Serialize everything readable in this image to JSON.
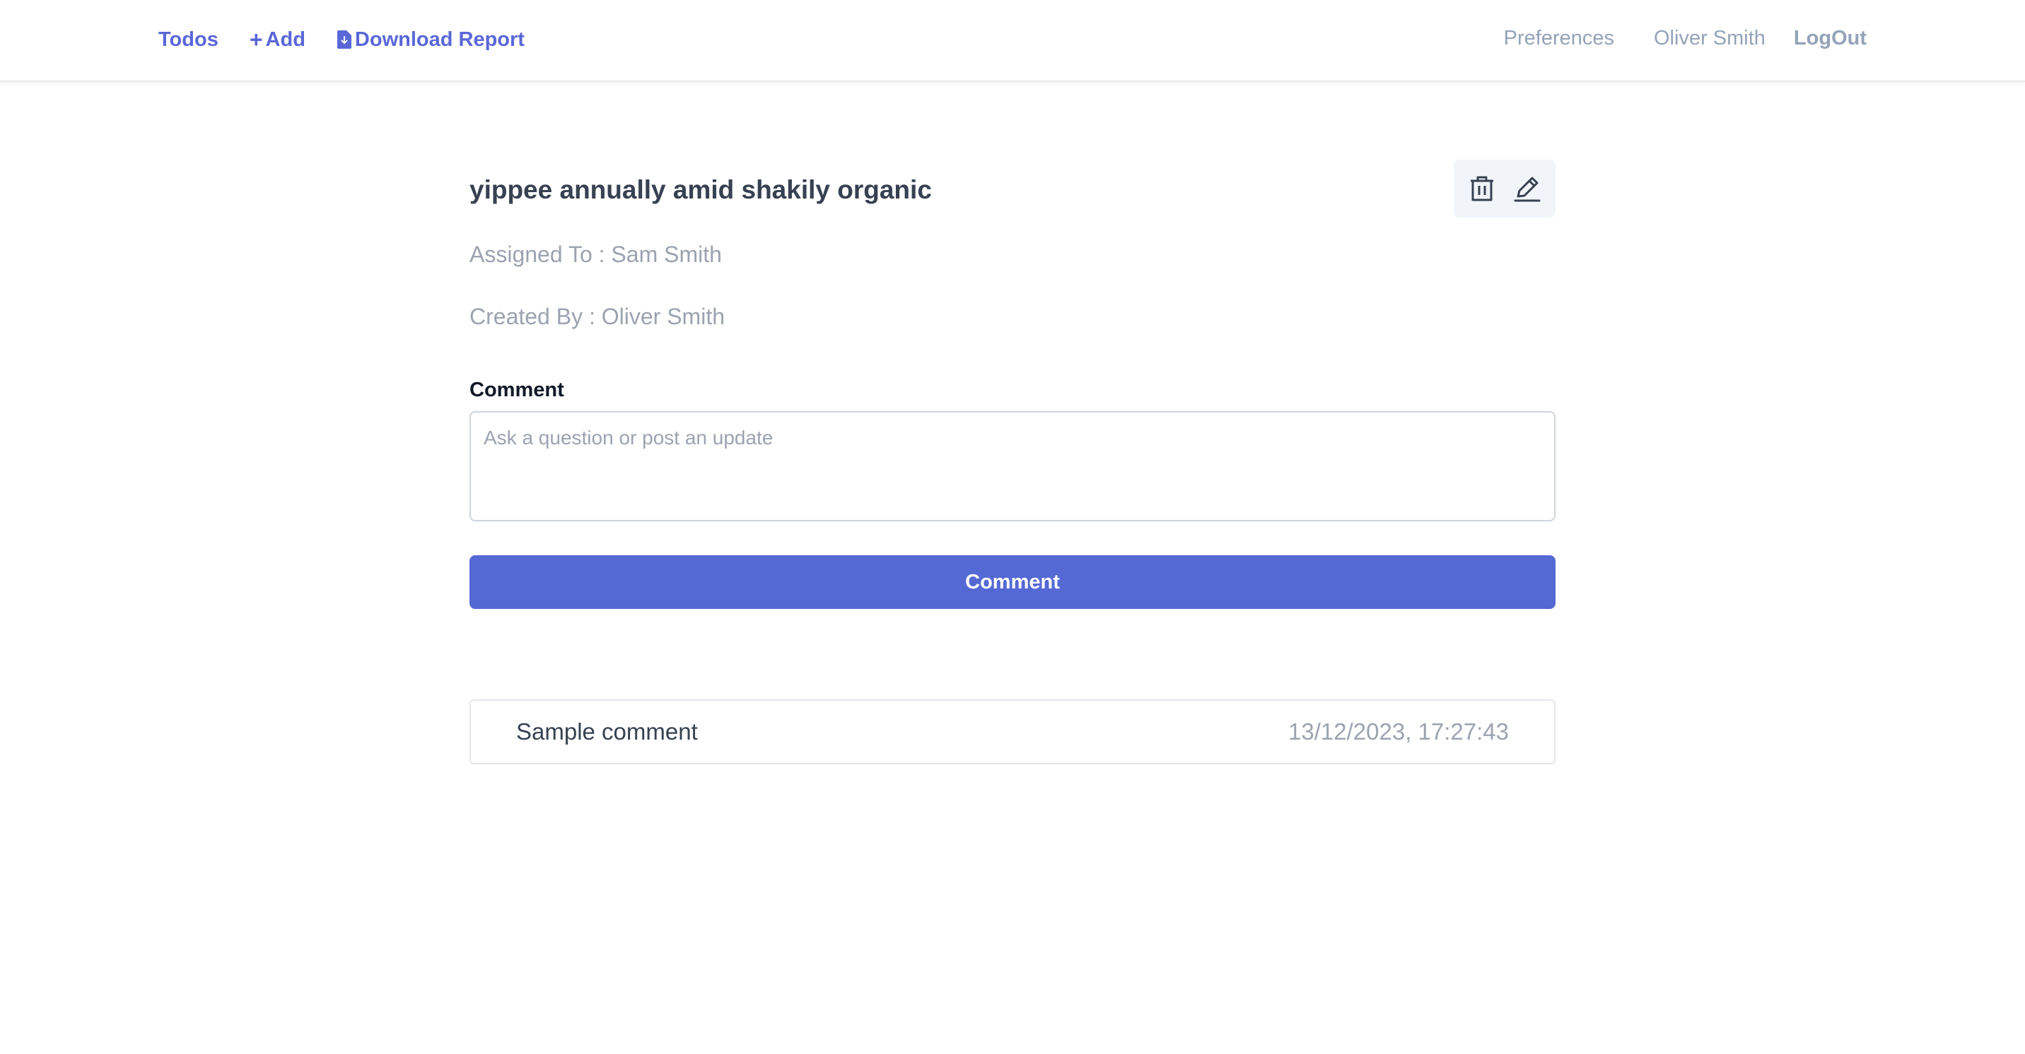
{
  "nav": {
    "todos_label": "Todos",
    "add_label": "Add",
    "download_label": "Download Report",
    "preferences_label": "Preferences",
    "user_name": "Oliver Smith",
    "logout_label": "LogOut"
  },
  "todo": {
    "title": "yippee annually amid shakily organic",
    "assigned_to": "Assigned To : Sam Smith",
    "created_by": "Created By : Oliver Smith"
  },
  "comment_form": {
    "label": "Comment",
    "placeholder": "Ask a question or post an update",
    "value": "",
    "button_label": "Comment"
  },
  "comments": [
    {
      "text": "Sample comment",
      "timestamp": "13/12/2023, 17:27:43"
    }
  ],
  "icons": {
    "delete": "trash-icon",
    "edit": "pencil-icon",
    "download": "file-download-icon"
  },
  "colors": {
    "accent": "#5a67d8",
    "button": "#5469d4",
    "muted": "#9ca3af"
  }
}
